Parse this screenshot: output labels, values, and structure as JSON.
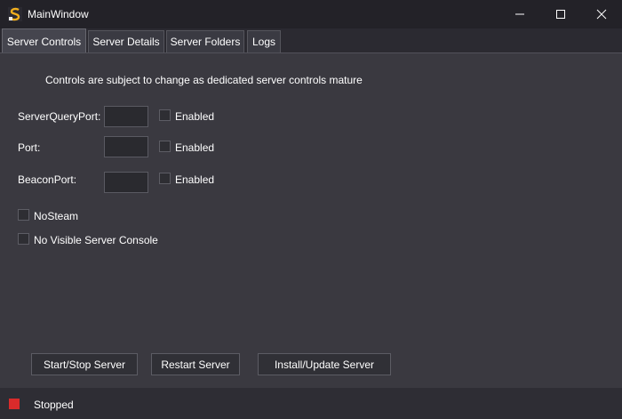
{
  "window": {
    "title": "MainWindow",
    "icon": "app-logo-icon",
    "controls": [
      "minimize-icon",
      "maximize-icon",
      "close-icon"
    ]
  },
  "tabs": [
    {
      "label": "Server Controls",
      "active": true
    },
    {
      "label": "Server Details",
      "active": false
    },
    {
      "label": "Server Folders",
      "active": false
    },
    {
      "label": "Logs",
      "active": false
    }
  ],
  "main": {
    "notice": "Controls are subject to change as dedicated server controls mature",
    "ports": [
      {
        "label": "ServerQueryPort:",
        "value": "",
        "enabled_label": "Enabled",
        "enabled": false
      },
      {
        "label": "Port:",
        "value": "",
        "enabled_label": "Enabled",
        "enabled": false
      },
      {
        "label": "BeaconPort:",
        "value": "",
        "enabled_label": "Enabled",
        "enabled": false
      }
    ],
    "options": [
      {
        "label": "NoSteam",
        "checked": false
      },
      {
        "label": "No Visible Server Console",
        "checked": false
      }
    ],
    "buttons": {
      "start_stop": "Start/Stop Server",
      "restart": "Restart Server",
      "install_update": "Install/Update Server"
    }
  },
  "status": {
    "text": "Stopped",
    "color": "#d92b2b"
  },
  "colors": {
    "background": "#2b2a31",
    "panel": "#3a3940",
    "titlebar": "#232228"
  }
}
